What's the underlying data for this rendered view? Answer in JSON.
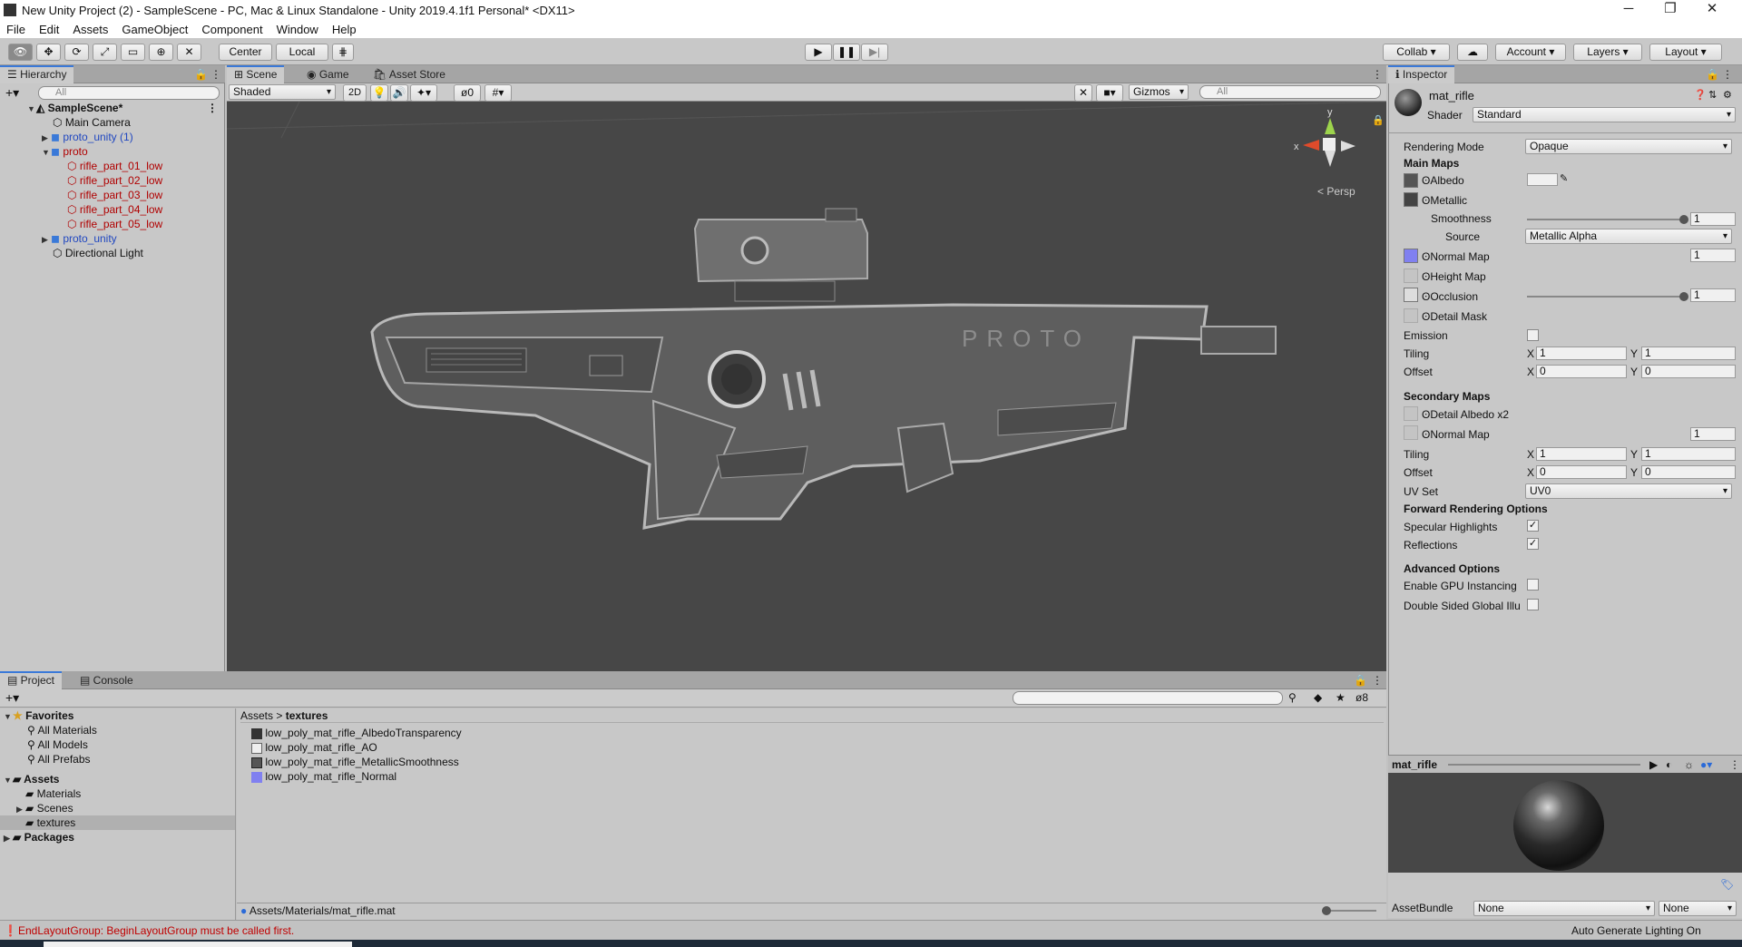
{
  "window": {
    "title": "New Unity Project (2) - SampleScene - PC, Mac & Linux Standalone - Unity 2019.4.1f1 Personal* <DX11>",
    "minimize": "─",
    "maximize": "❐",
    "close": "✕"
  },
  "menu": [
    "File",
    "Edit",
    "Assets",
    "GameObject",
    "Component",
    "Window",
    "Help"
  ],
  "toolbar": {
    "center": "Center",
    "local": "Local",
    "collab": "Collab",
    "account": "Account",
    "layers": "Layers",
    "layout": "Layout"
  },
  "hierarchy": {
    "tab": "Hierarchy",
    "search_placeholder": "All",
    "scene": "SampleScene*",
    "items": [
      {
        "label": "Main Camera"
      },
      {
        "label": "proto_unity (1)"
      },
      {
        "label": "proto"
      },
      {
        "label": "rifle_part_01_low"
      },
      {
        "label": "rifle_part_02_low"
      },
      {
        "label": "rifle_part_03_low"
      },
      {
        "label": "rifle_part_04_low"
      },
      {
        "label": "rifle_part_05_low"
      },
      {
        "label": "proto_unity"
      },
      {
        "label": "Directional Light"
      }
    ]
  },
  "scene": {
    "tabs": [
      "Scene",
      "Game",
      "Asset Store"
    ],
    "shading": "Shaded",
    "mode2d": "2D",
    "hidden_count": "0",
    "gizmos": "Gizmos",
    "search_placeholder": "All",
    "persp": "Persp",
    "gizmo_y": "y",
    "gizmo_x": "x",
    "model_text": "PROTO"
  },
  "inspector": {
    "tab": "Inspector",
    "material": "mat_rifle",
    "shader_label": "Shader",
    "shader": "Standard",
    "rendering_mode_label": "Rendering Mode",
    "rendering_mode": "Opaque",
    "main_maps": "Main Maps",
    "albedo": "Albedo",
    "metallic": "Metallic",
    "smoothness": "Smoothness",
    "smoothness_val": "1",
    "source": "Source",
    "source_val": "Metallic Alpha",
    "normal_map": "Normal Map",
    "normal_val": "1",
    "height_map": "Height Map",
    "occlusion": "Occlusion",
    "occlusion_val": "1",
    "detail_mask": "Detail Mask",
    "emission": "Emission",
    "tiling": "Tiling",
    "offset": "Offset",
    "x": "X",
    "y": "Y",
    "one": "1",
    "zero": "0",
    "secondary_maps": "Secondary Maps",
    "detail_albedo": "Detail Albedo x2",
    "normal_map2": "Normal Map",
    "normal_val2": "1",
    "uv_set": "UV Set",
    "uv_val": "UV0",
    "forward": "Forward Rendering Options",
    "specular": "Specular Highlights",
    "reflections": "Reflections",
    "advanced": "Advanced Options",
    "gpu_instancing": "Enable GPU Instancing",
    "double_sided": "Double Sided Global Illu",
    "preview_name": "mat_rifle",
    "assetbundle": "AssetBundle",
    "ab_none1": "None",
    "ab_none2": "None"
  },
  "project": {
    "tabs": [
      "Project",
      "Console"
    ],
    "favorites": "Favorites",
    "fav_items": [
      "All Materials",
      "All Models",
      "All Prefabs"
    ],
    "assets": "Assets",
    "asset_folders": [
      "Materials",
      "Scenes",
      "textures"
    ],
    "packages": "Packages",
    "breadcrumb_root": "Assets",
    "breadcrumb_sep": ">",
    "breadcrumb_leaf": "textures",
    "files": [
      "low_poly_mat_rifle_AlbedoTransparency",
      "low_poly_mat_rifle_AO",
      "low_poly_mat_rifle_MetallicSmoothness",
      "low_poly_mat_rifle_Normal"
    ],
    "hidden_count": "8",
    "path": "Assets/Materials/mat_rifle.mat"
  },
  "status": {
    "error": "EndLayoutGroup: BeginLayoutGroup must be called first.",
    "lighting": "Auto Generate Lighting On"
  }
}
